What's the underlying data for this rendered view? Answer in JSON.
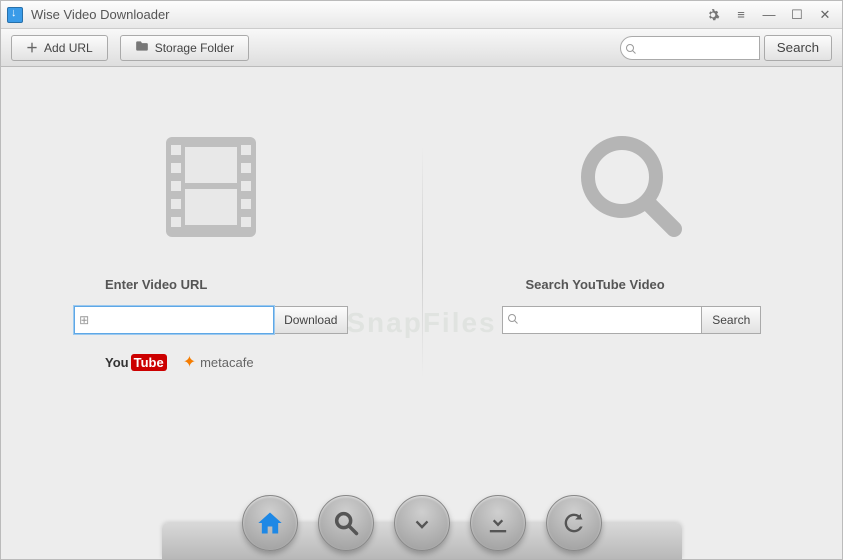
{
  "app": {
    "title": "Wise Video Downloader"
  },
  "toolbar": {
    "add_url_label": "Add URL",
    "storage_folder_label": "Storage Folder",
    "search_label": "Search"
  },
  "left_panel": {
    "label": "Enter Video URL",
    "input_value": "",
    "download_label": "Download",
    "brands": {
      "youtube_you": "You",
      "youtube_tube": "Tube",
      "metacafe": "metacafe"
    }
  },
  "right_panel": {
    "label": "Search YouTube Video",
    "input_value": "",
    "search_label": "Search"
  },
  "dock": {
    "home": "home-icon",
    "search": "search-icon",
    "download": "download-icon",
    "download_to": "download-to-icon",
    "refresh": "refresh-icon"
  },
  "watermark": "SnapFiles"
}
